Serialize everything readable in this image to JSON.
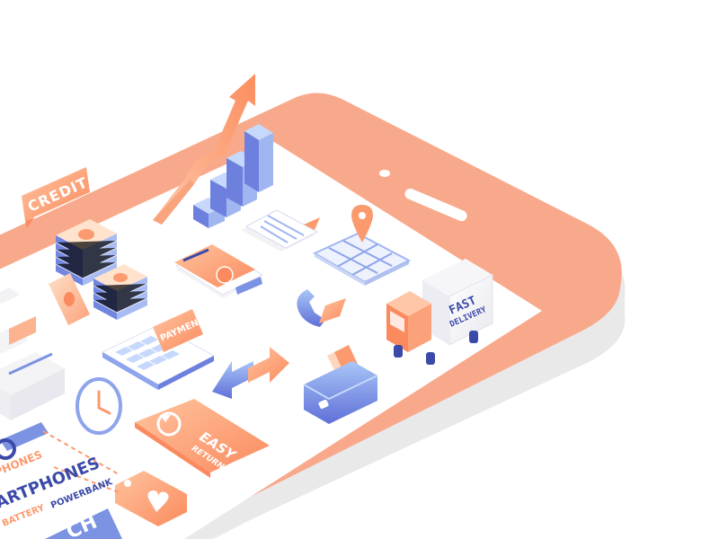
{
  "labels": {
    "credit": "CREDIT",
    "payments": "PAYMENTS",
    "fast": "FAST",
    "delivery": "DELIVERY",
    "easy": "EASY",
    "returns": "RETURNS",
    "phones": "PHONES",
    "smartphones": "ARTPHONES",
    "battery": "BATTERY",
    "powerbank": "POWERBANK",
    "search_fragment": "CH"
  },
  "icons": {
    "growth_arrow": "trending-up-arrow-icon",
    "bar_chart": "bar-chart-icon",
    "document": "document-icon",
    "map_pin": "map-location-icon",
    "credit_card": "credit-card-icon",
    "phone": "phone-icon",
    "truck": "delivery-truck-icon",
    "money": "rupee-money-stack-icon",
    "calculator": "payments-calculator-icon",
    "transfer": "exchange-arrows-icon",
    "wallet": "wallet-icon",
    "clock": "clock-icon",
    "return": "easy-returns-icon",
    "tag": "price-tag-heart-icon"
  },
  "colors": {
    "phone_frame": "#f9a98b",
    "phone_edge": "#ebebeb",
    "screen": "#ffffff",
    "orange": "#fb9a6e",
    "orange_light": "#ffd2b5",
    "blue": "#7c92e3",
    "blue_light": "#b6d0f7",
    "navy": "#3b4aa8"
  }
}
